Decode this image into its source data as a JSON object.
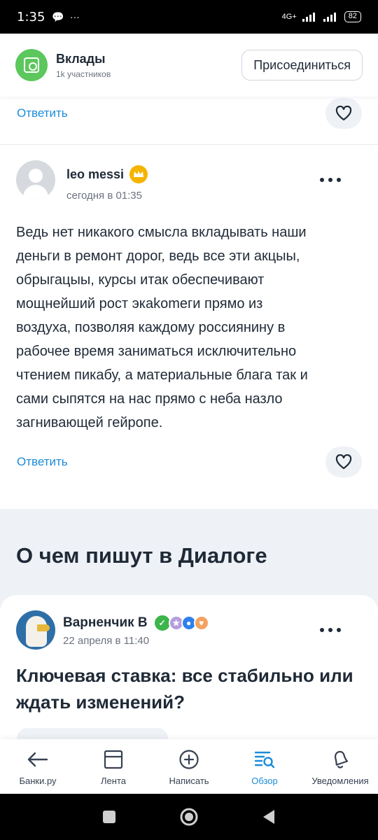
{
  "status_bar": {
    "time": "1:35",
    "network": "4G+",
    "battery": "82"
  },
  "group": {
    "title": "Вклады",
    "members": "1k участников",
    "join_label": "Присоединиться"
  },
  "top_reply": {
    "reply_label": "Ответить"
  },
  "comment": {
    "author": "leo messi",
    "time": "сегодня в 01:35",
    "lines": [
      "Ведь нет никакого смысла вкладывать наши",
      "деньги в ремонт дорог, ведь все эти акцыы,",
      "обрыгацыы, курсы итак обеспечивают",
      "мощнейший рост экаkomeги прямо из",
      "воздуха, позволяя каждому россиянину в",
      "рабочее время заниматься исключительно",
      "чтением пикабу, а материальные блага так и",
      "сами сыпятся на нас прямо с неба назло",
      "загнивающей гейропе."
    ],
    "reply_label": "Ответить"
  },
  "section": {
    "title": "О чем пишут в Диалоге"
  },
  "post": {
    "author": "Варненчик В",
    "time": "22 апреля в 11:40",
    "title_line1": "Ключевая ставка: все стабильно или",
    "title_line2": "ждать изменений?"
  },
  "bottom_nav": [
    {
      "label": "Банки.ру",
      "icon": "arrow-left-icon"
    },
    {
      "label": "Лента",
      "icon": "feed-icon"
    },
    {
      "label": "Написать",
      "icon": "plus-circle-icon"
    },
    {
      "label": "Обзор",
      "icon": "overview-icon",
      "active": true
    },
    {
      "label": "Уведомления",
      "icon": "bell-icon"
    }
  ],
  "colors": {
    "accent": "#1a8cd8",
    "group_green": "#5cc75c",
    "crown": "#f5b400",
    "section_bg": "#eef1f6"
  }
}
